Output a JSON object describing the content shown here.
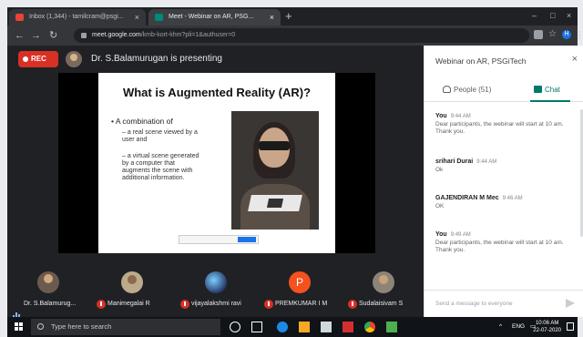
{
  "browser": {
    "tabs": [
      {
        "title": "Inbox (1,344) - tamilcram@psgi...",
        "close": "×"
      },
      {
        "title": "Meet - Webinar on AR, PSG...",
        "close": "×"
      }
    ],
    "new_tab": "+",
    "window_controls": [
      "–",
      "□",
      "×"
    ],
    "address": {
      "host": "meet.google.com",
      "path": "/kmb-kort-khm?pli=1&authuser=0"
    },
    "profile_letter": "H"
  },
  "meet": {
    "rec_label": "REC",
    "presenting_text": "Dr. S.Balamurugan is presenting",
    "slide": {
      "title": "What is Augmented Reality (AR)?",
      "bullet": "A combination of",
      "subpoints": [
        "– a real scene viewed by a user and",
        "– a virtual scene generated by a computer that augments the scene with additional information."
      ]
    },
    "participants": [
      {
        "name": "Dr. S.Balamurug...",
        "muted": false
      },
      {
        "name": "Manimegalai R",
        "muted": true
      },
      {
        "name": "vijayalakshmi ravi",
        "muted": true
      },
      {
        "name": "PREMKUMAR I M",
        "muted": true,
        "initial": "P"
      },
      {
        "name": "Sudalaisivam S",
        "muted": true
      }
    ]
  },
  "panel": {
    "title": "Webinar on AR, PSGiTech",
    "close": "×",
    "tabs": {
      "people": "People (51)",
      "chat": "Chat"
    },
    "messages": [
      {
        "sender": "You",
        "time": "9:44 AM",
        "text": "Dear participants, the webinar will start at 10 am. Thank you."
      },
      {
        "sender": "srihari Durai",
        "time": "9:44 AM",
        "text": "Ok"
      },
      {
        "sender": "GAJENDIRAN M Mec",
        "time": "9:46 AM",
        "text": "OK"
      },
      {
        "sender": "You",
        "time": "9:49 AM",
        "text": "Dear participants, the webinar will start at 10 am. Thank you."
      }
    ],
    "input_placeholder": "Send a message to everyone"
  },
  "taskbar": {
    "search_placeholder": "Type here to search",
    "lang": "ENG",
    "time": "10:06 AM",
    "date": "22-07-2020"
  },
  "colors": {
    "rec": "#d93025",
    "chat_accent": "#00796b",
    "meet_bg": "#202124"
  }
}
